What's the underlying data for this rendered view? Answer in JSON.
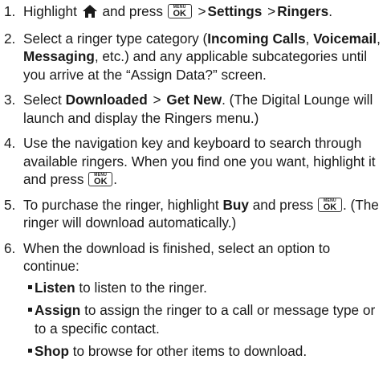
{
  "steps": [
    {
      "num": "1.",
      "t1": "Highlight",
      "t2": "and press",
      "sep": ">",
      "b1": "Settings",
      "b2": "Ringers",
      "end": "."
    },
    {
      "num": "2.",
      "t1": "Select a ringer type category (",
      "b1": "Incoming Calls",
      "c1": ",",
      "b2": "Voicemail",
      "c2": ",",
      "b3": "Messaging",
      "t2": ", etc.) and any applicable subcategories until you arrive at the “Assign Data?” screen."
    },
    {
      "num": "3.",
      "t1": "Select",
      "b1": "Downloaded",
      "sep": ">",
      "b2": "Get New",
      "t2": ". (The Digital Lounge will launch and display the Ringers menu.)"
    },
    {
      "num": "4.",
      "t1": "Use the navigation key and keyboard to search through available ringers. When you find one you want, highlight it and press",
      "end": "."
    },
    {
      "num": "5.",
      "t1": "To purchase the ringer, highlight",
      "b1": "Buy",
      "t2": "and press",
      "t3": ". (The ringer will download automatically.)"
    },
    {
      "num": "6.",
      "t1": "When the download is finished, select an option to continue:"
    }
  ],
  "options": [
    {
      "label": "Listen",
      "text": "to listen to the ringer."
    },
    {
      "label": "Assign",
      "text": "to assign the ringer to a call or message type or to a specific contact."
    },
    {
      "label": "Shop",
      "text": "to browse for other items to download."
    }
  ],
  "key": {
    "top": "MENU",
    "bottom": "OK"
  },
  "icons": {
    "home": "home-icon",
    "menu_ok": "menu-ok-key-icon"
  }
}
